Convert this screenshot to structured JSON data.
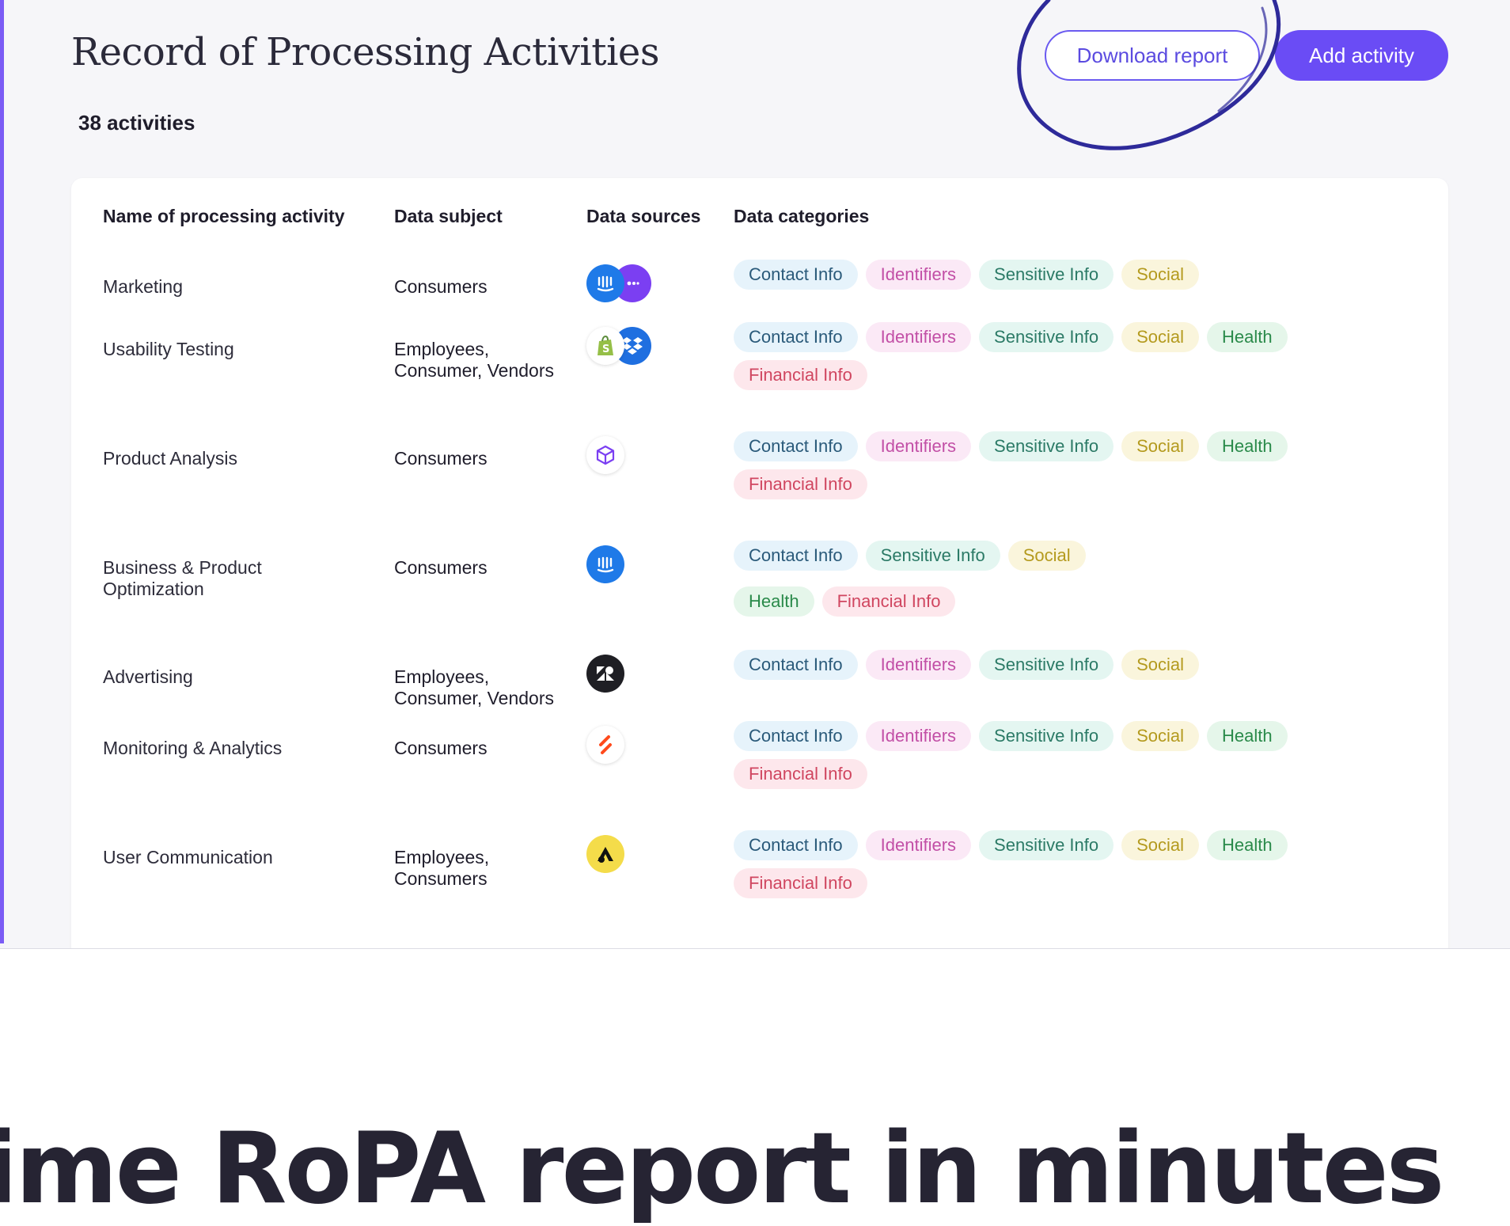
{
  "header": {
    "title": "Record of Processing Activities",
    "count_label": "38 activities",
    "download_label": "Download report",
    "add_label": "Add activity"
  },
  "table": {
    "columns": {
      "name": "Name of processing activity",
      "subject": "Data subject",
      "sources": "Data sources",
      "categories": "Data categories"
    },
    "rows": [
      {
        "name": "Marketing",
        "subject": "Consumers",
        "sources": [
          "intercom-icon",
          "chat-bubble-icon"
        ],
        "categories": [
          "Contact Info",
          "Identifiers",
          "Sensitive Info",
          "Social"
        ]
      },
      {
        "name": "Usability Testing",
        "subject": "Employees, Consumer, Vendors",
        "sources": [
          "shopify-icon",
          "dropbox-icon"
        ],
        "categories": [
          "Contact Info",
          "Identifiers",
          "Sensitive Info",
          "Social",
          "Health",
          "Financial Info"
        ]
      },
      {
        "name": "Product Analysis",
        "subject": "Consumers",
        "sources": [
          "cube-icon"
        ],
        "categories": [
          "Contact Info",
          "Identifiers",
          "Sensitive Info",
          "Social",
          "Health",
          "Financial Info"
        ]
      },
      {
        "name": "Business & Product Optimization",
        "subject": "Consumers",
        "sources": [
          "intercom-icon"
        ],
        "categories": [
          "Contact Info",
          "Sensitive Info",
          "Social",
          "Health",
          "Financial Info"
        ]
      },
      {
        "name": "Advertising",
        "subject": "Employees, Consumer, Vendors",
        "sources": [
          "zendesk-icon"
        ],
        "categories": [
          "Contact Info",
          "Identifiers",
          "Sensitive Info",
          "Social"
        ]
      },
      {
        "name": "Monitoring & Analytics",
        "subject": "Consumers",
        "sources": [
          "zapier-icon"
        ],
        "categories": [
          "Contact Info",
          "Identifiers",
          "Sensitive Info",
          "Social",
          "Health",
          "Financial Info"
        ]
      },
      {
        "name": "User Communication",
        "subject": "Employees, Consumers",
        "sources": [
          "triangle-logo-icon"
        ],
        "categories": [
          "Contact Info",
          "Identifiers",
          "Sensitive Info",
          "Social",
          "Health",
          "Financial Info"
        ]
      }
    ]
  },
  "headline": "ime RoPA report in minutes",
  "colors": {
    "accent": "#6a4cf5",
    "background": "#f6f6f9",
    "annotation_circle": "#2e2a9a"
  }
}
